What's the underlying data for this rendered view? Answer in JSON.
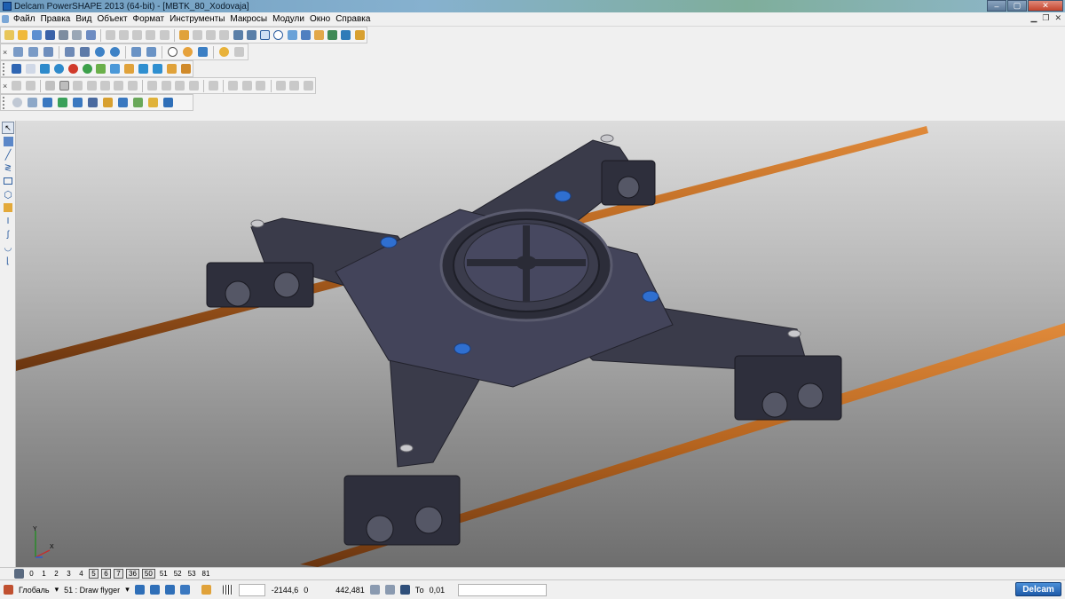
{
  "window": {
    "title": "Delcam PowerSHAPE 2013 (64-bit) - [MBTK_80_Xodovaja]",
    "buttons": [
      "–",
      "▢",
      "✕"
    ]
  },
  "menubar": {
    "items": [
      "Файл",
      "Правка",
      "Вид",
      "Объект",
      "Формат",
      "Инструменты",
      "Макросы",
      "Модули",
      "Окно",
      "Справка"
    ]
  },
  "levels": {
    "items": [
      "0",
      "1",
      "2",
      "3",
      "4",
      "5",
      "6",
      "7",
      "36",
      "50",
      "51",
      "52",
      "53",
      "81"
    ],
    "on": [
      "5",
      "6",
      "7",
      "36",
      "50"
    ]
  },
  "status": {
    "workplane": "Глобаль",
    "level_select": "51 : Draw flyger",
    "x_value": "-2144,6",
    "y_value": "0",
    "z_value": "442,481",
    "tol_label": "То",
    "tolerance": "0,01",
    "brand": "Delcam"
  },
  "colors": {
    "model": "#3a3b4a",
    "rail": "#b5641f",
    "accent": "#2f6fd0"
  }
}
